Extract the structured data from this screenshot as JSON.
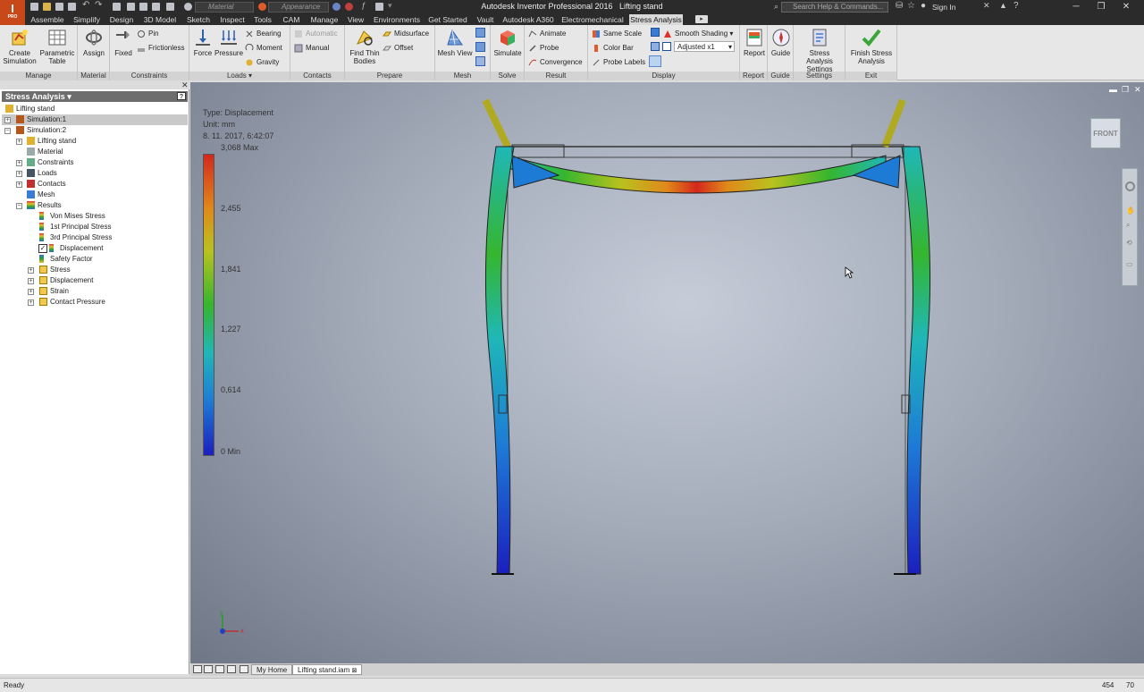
{
  "app": {
    "badge": "I",
    "badge_sub": "PRO",
    "title": "Autodesk Inventor Professional 2016",
    "document": "Lifting stand"
  },
  "qat": {
    "material": "Material",
    "appearance": "Appearance"
  },
  "search": {
    "placeholder": "Search Help & Commands...",
    "signin": "Sign In"
  },
  "menu_tabs": [
    "Assemble",
    "Simplify",
    "Design",
    "3D Model",
    "Sketch",
    "Inspect",
    "Tools",
    "CAM",
    "Manage",
    "View",
    "Environments",
    "Get Started",
    "Vault",
    "Autodesk A360",
    "Electromechanical",
    "Stress Analysis"
  ],
  "ribbon": {
    "groups": [
      "Manage",
      "Material",
      "Constraints",
      "Loads ▾",
      "Contacts",
      "Prepare",
      "Mesh",
      "Solve",
      "Result",
      "Display",
      "Report",
      "Guide",
      "Settings",
      "Exit"
    ],
    "create_simulation": "Create Simulation",
    "parametric_table": "Parametric Table",
    "assign": "Assign",
    "fixed": "Fixed",
    "pin": "Pin",
    "frictionless": "Frictionless",
    "force": "Force",
    "pressure": "Pressure",
    "bearing": "Bearing",
    "moment": "Moment",
    "gravity": "Gravity",
    "automatic": "Automatic",
    "manual": "Manual",
    "find_thin_bodies": "Find Thin Bodies",
    "midsurface": "Midsurface",
    "offset": "Offset",
    "mesh_view": "Mesh View",
    "simulate": "Simulate",
    "animate": "Animate",
    "probe": "Probe",
    "convergence": "Convergence",
    "same_scale": "Same Scale",
    "color_bar": "Color Bar",
    "probe_labels": "Probe Labels",
    "smooth_shading": "Smooth Shading",
    "adjusted": "Adjusted x1",
    "report": "Report",
    "guide": "Guide",
    "settings": "Stress Analysis Settings",
    "finish": "Finish Stress Analysis"
  },
  "browser": {
    "header": "Stress Analysis ▾",
    "nodes": [
      {
        "label": "Lifting stand"
      },
      {
        "label": "Simulation:1"
      },
      {
        "label": "Simulation:2"
      },
      {
        "label": "Lifting stand"
      },
      {
        "label": "Material"
      },
      {
        "label": "Constraints"
      },
      {
        "label": "Loads"
      },
      {
        "label": "Contacts"
      },
      {
        "label": "Mesh"
      },
      {
        "label": "Results"
      },
      {
        "label": "Von Mises Stress"
      },
      {
        "label": "1st Principal Stress"
      },
      {
        "label": "3rd Principal Stress"
      },
      {
        "label": "Displacement"
      },
      {
        "label": "Safety Factor"
      },
      {
        "label": "Stress"
      },
      {
        "label": "Displacement"
      },
      {
        "label": "Strain"
      },
      {
        "label": "Contact Pressure"
      }
    ]
  },
  "viewport": {
    "info_type": "Type: Displacement",
    "info_unit": "Unit: mm",
    "info_date": "8. 11. 2017, 6:42:07",
    "legend": [
      "3,068 Max",
      "2,455",
      "1,841",
      "1,227",
      "0,614",
      "0 Min"
    ],
    "viewcube": "FRONT",
    "axis_y": "y",
    "axis_x": "x"
  },
  "doc_tabs": {
    "home": "My Home",
    "file": "Lifting stand.iam"
  },
  "status": {
    "text": "Ready",
    "n1": "454",
    "n2": "70"
  }
}
